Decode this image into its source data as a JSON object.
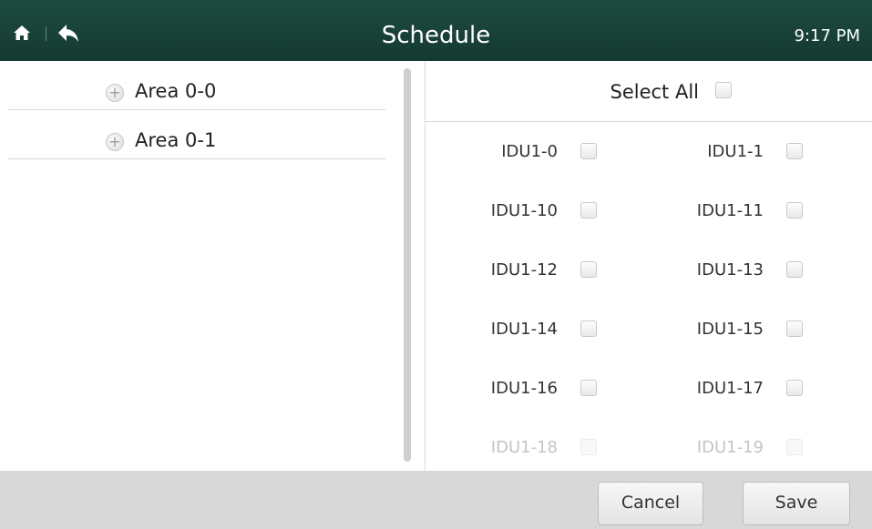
{
  "header": {
    "title": "Schedule",
    "clock": "9:17 PM",
    "icons": [
      "home-icon",
      "back-icon"
    ],
    "background_color": "#1d4a3f"
  },
  "left_panel": {
    "areas": [
      {
        "label": "Area 0-0",
        "icon": "plus-icon"
      },
      {
        "label": "Area 0-1",
        "icon": "plus-icon"
      }
    ]
  },
  "right_panel": {
    "select_all_label": "Select All",
    "select_all_checked": false,
    "units": [
      {
        "label": "IDU1-0",
        "checked": false,
        "faded": false
      },
      {
        "label": "IDU1-1",
        "checked": false,
        "faded": false
      },
      {
        "label": "IDU1-10",
        "checked": false,
        "faded": false
      },
      {
        "label": "IDU1-11",
        "checked": false,
        "faded": false
      },
      {
        "label": "IDU1-12",
        "checked": false,
        "faded": false
      },
      {
        "label": "IDU1-13",
        "checked": false,
        "faded": false
      },
      {
        "label": "IDU1-14",
        "checked": false,
        "faded": false
      },
      {
        "label": "IDU1-15",
        "checked": false,
        "faded": false
      },
      {
        "label": "IDU1-16",
        "checked": false,
        "faded": false
      },
      {
        "label": "IDU1-17",
        "checked": false,
        "faded": false
      },
      {
        "label": "IDU1-18",
        "checked": false,
        "faded": true
      },
      {
        "label": "IDU1-19",
        "checked": false,
        "faded": true
      }
    ]
  },
  "footer": {
    "cancel_label": "Cancel",
    "save_label": "Save"
  }
}
